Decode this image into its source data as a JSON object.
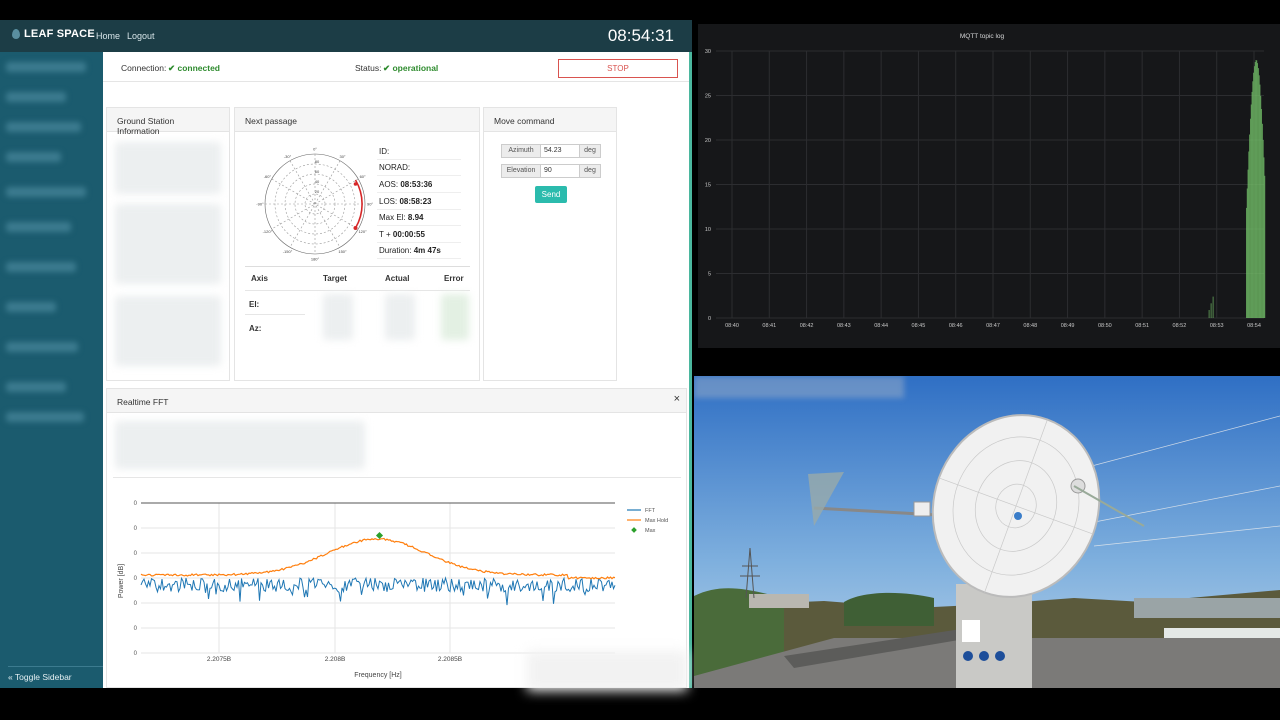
{
  "app": {
    "brand": "LEAF SPACE",
    "nav": {
      "home": "Home",
      "logout": "Logout"
    },
    "clock": "08:54:31",
    "toggle_sidebar": "« Toggle Sidebar"
  },
  "status_bar": {
    "connection_label": "Connection:",
    "connection_value": "✔ connected",
    "status_label": "Status:",
    "status_value": "✔ operational",
    "stop_label": "STOP"
  },
  "panels": {
    "ground_station_title": "Ground Station Information",
    "next_passage_title": "Next passage",
    "move_command_title": "Move command",
    "fft_title": "Realtime FFT",
    "fft_close": "×"
  },
  "next_passage": {
    "id_label": "ID:",
    "norad_label": "NORAD:",
    "aos_label": "AOS:",
    "aos_value": "08:53:36",
    "los_label": "LOS:",
    "los_value": "08:58:23",
    "maxel_label": "Max El:",
    "maxel_value": "8.94",
    "t_label": "T +",
    "t_value": "00:00:55",
    "duration_label": "Duration:",
    "duration_value": "4m 47s",
    "polar_az_labels": [
      "0°",
      "30°",
      "60°",
      "90°",
      "120°",
      "150°",
      "180°",
      "-150°",
      "-120°",
      "-90°",
      "-60°",
      "-30°"
    ],
    "polar_el_labels": [
      "80",
      "60",
      "40",
      "20"
    ],
    "table_headers": [
      "Axis",
      "Target",
      "Actual",
      "Error"
    ],
    "table_rows": [
      "El:",
      "Az:"
    ]
  },
  "move_command": {
    "azimuth_label": "Azimuth",
    "azimuth_value": "54.23",
    "azimuth_unit": "deg",
    "elevation_label": "Elevation",
    "elevation_value": "90",
    "elevation_unit": "deg",
    "send_label": "Send"
  },
  "fft_chart": {
    "ylabel": "Power [dB]",
    "xlabel": "Frequency [Hz]",
    "x_ticks": [
      "2.2075B",
      "2.208B",
      "2.2085B"
    ],
    "y_ticks": [
      "0",
      "0",
      "0",
      "0",
      "0",
      "0",
      "0",
      "0"
    ],
    "legend": [
      "FFT",
      "Max Hold",
      "Max"
    ],
    "colors": {
      "fft": "#1f77b4",
      "maxhold": "#ff7f0e",
      "max": "#2ca02c"
    }
  },
  "chart_data": [
    {
      "type": "bar",
      "title": "MQTT topic log",
      "categories": [
        "08:40",
        "08:41",
        "08:42",
        "08:43",
        "08:44",
        "08:45",
        "08:46",
        "08:47",
        "08:48",
        "08:49",
        "08:50",
        "08:51",
        "08:52",
        "08:53",
        "08:54"
      ],
      "ylim": [
        0,
        30
      ],
      "y_ticks": [
        "0",
        "5",
        "10",
        "15",
        "20",
        "25",
        "30"
      ],
      "grid": true,
      "bar_color": "#73bf69",
      "values": [
        0,
        0,
        0,
        0,
        0,
        0,
        0,
        0,
        0,
        0,
        0,
        0,
        0,
        3,
        29
      ]
    }
  ],
  "camera": {}
}
